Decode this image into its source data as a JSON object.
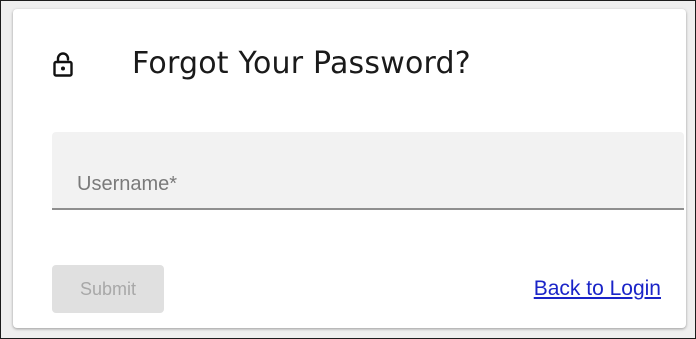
{
  "form": {
    "title": "Forgot Your Password?",
    "icon": "lock-icon",
    "username": {
      "placeholder": "Username*",
      "value": ""
    },
    "submit_label": "Submit",
    "back_link_label": "Back to Login"
  },
  "colors": {
    "link": "#1a24c8",
    "button_disabled_bg": "#e0e0e0",
    "button_disabled_text": "#a8a8a8",
    "field_bg": "#f2f2f2"
  }
}
